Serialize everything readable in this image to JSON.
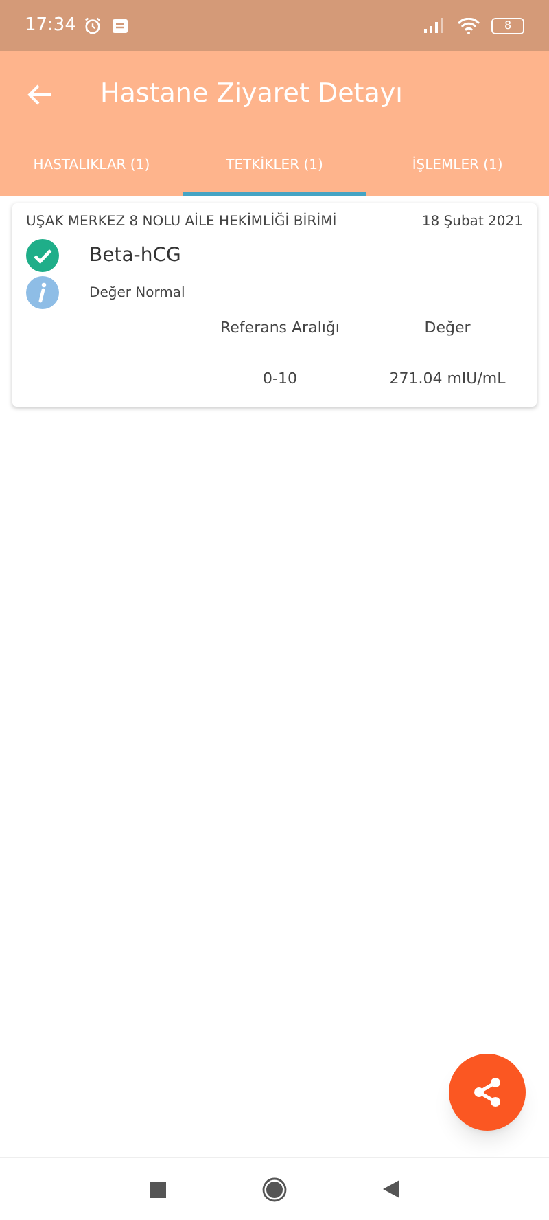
{
  "status_bar": {
    "time": "17:34",
    "battery": "8"
  },
  "app_bar": {
    "title": "Hastane Ziyaret Detayı"
  },
  "tabs": [
    {
      "label": "HASTALIKLAR (1)",
      "selected": false
    },
    {
      "label": "TETKİKLER (1)",
      "selected": true
    },
    {
      "label": "İŞLEMLER (1)",
      "selected": false
    }
  ],
  "results": [
    {
      "facility": "UŞAK MERKEZ 8 NOLU AİLE HEKİMLİĞİ BİRİMİ",
      "date": "18 Şubat 2021",
      "test": "Beta-hCG",
      "verified": true,
      "note": "Değer Normal",
      "range_label": "Referans Aralığı",
      "value_label": "Değer",
      "range": "0-10",
      "value": "271.04 mIU/mL"
    }
  ]
}
